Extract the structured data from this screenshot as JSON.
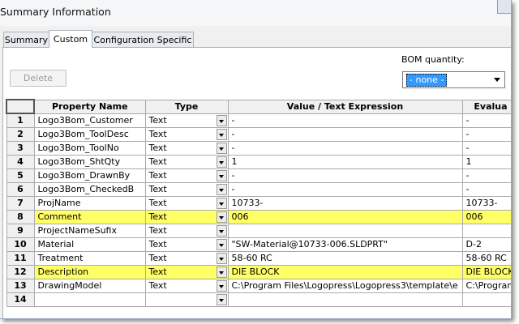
{
  "window": {
    "title": "Summary Information"
  },
  "tabs": [
    {
      "label": "Summary"
    },
    {
      "label": "Custom",
      "active": true
    },
    {
      "label": "Configuration Specific"
    }
  ],
  "toolbar": {
    "delete_label": "Delete"
  },
  "bom": {
    "label": "BOM quantity:",
    "value": "- none -"
  },
  "table": {
    "headers": [
      "Property Name",
      "Type",
      "Value / Text Expression",
      "Evalua"
    ],
    "highlight_color": "#ffff66",
    "rows": [
      {
        "num": "1",
        "name": "Logo3Bom_Customer",
        "type": "Text",
        "value": "-",
        "eval": "-",
        "highlight": false
      },
      {
        "num": "2",
        "name": "Logo3Bom_ToolDesc",
        "type": "Text",
        "value": "-",
        "eval": "-",
        "highlight": false
      },
      {
        "num": "3",
        "name": "Logo3Bom_ToolNo",
        "type": "Text",
        "value": "-",
        "eval": "-",
        "highlight": false
      },
      {
        "num": "4",
        "name": "Logo3Bom_ShtQty",
        "type": "Text",
        "value": "1",
        "eval": "1",
        "highlight": false
      },
      {
        "num": "5",
        "name": "Logo3Bom_DrawnBy",
        "type": "Text",
        "value": "-",
        "eval": "-",
        "highlight": false
      },
      {
        "num": "6",
        "name": "Logo3Bom_CheckedB",
        "type": "Text",
        "value": "-",
        "eval": "-",
        "highlight": false
      },
      {
        "num": "7",
        "name": "ProjName",
        "type": "Text",
        "value": "10733-",
        "eval": "10733-",
        "highlight": false
      },
      {
        "num": "8",
        "name": "Comment",
        "type": "Text",
        "value": "006",
        "eval": "006",
        "highlight": true
      },
      {
        "num": "9",
        "name": "ProjectNameSufix",
        "type": "Text",
        "value": "",
        "eval": "",
        "highlight": false
      },
      {
        "num": "10",
        "name": "Material",
        "type": "Text",
        "value": "\"SW-Material@10733-006.SLDPRT\"",
        "eval": "D-2",
        "highlight": false
      },
      {
        "num": "11",
        "name": "Treatment",
        "type": "Text",
        "value": "58-60 RC",
        "eval": "58-60 RC",
        "highlight": false
      },
      {
        "num": "12",
        "name": "Description",
        "type": "Text",
        "value": "DIE BLOCK",
        "eval": "DIE BLOCK",
        "highlight": true
      },
      {
        "num": "13",
        "name": "DrawingModel",
        "type": "Text",
        "value": "C:\\Program Files\\Logopress\\Logopress3\\template\\e",
        "eval": "C:\\Program",
        "highlight": false
      },
      {
        "num": "14",
        "name": "",
        "type": "",
        "value": "",
        "eval": "",
        "highlight": false
      }
    ]
  }
}
